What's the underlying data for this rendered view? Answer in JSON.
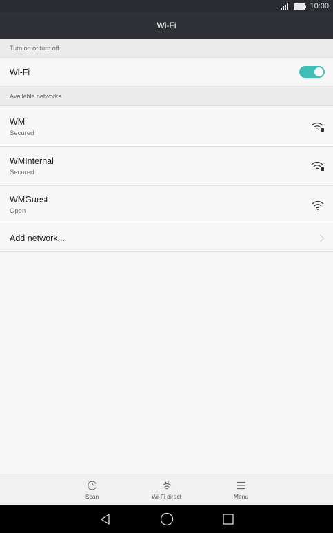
{
  "status_bar": {
    "time": "10:00",
    "icons": [
      "signal-icon",
      "battery-icon"
    ]
  },
  "header": {
    "title": "Wi-Fi"
  },
  "sections": {
    "toggle_header": "Turn on or turn off",
    "networks_header": "Available networks"
  },
  "wifi_toggle": {
    "label": "Wi-Fi",
    "on": true
  },
  "networks": [
    {
      "name": "WM",
      "status": "Secured",
      "icon": "wifi-locked-icon"
    },
    {
      "name": "WMInternal",
      "status": "Secured",
      "icon": "wifi-locked-icon"
    },
    {
      "name": "WMGuest",
      "status": "Open",
      "icon": "wifi-icon"
    }
  ],
  "add_network": {
    "label": "Add network..."
  },
  "actions": [
    {
      "label": "Scan",
      "icon": "scan-icon"
    },
    {
      "label": "Wi-Fi direct",
      "icon": "wifi-direct-icon"
    },
    {
      "label": "Menu",
      "icon": "menu-icon"
    }
  ],
  "nav": [
    "back-icon",
    "home-icon",
    "recents-icon"
  ],
  "colors": {
    "accent": "#3fbfb8",
    "title_bar": "#2f3136",
    "status_bar": "#2a2c31"
  }
}
